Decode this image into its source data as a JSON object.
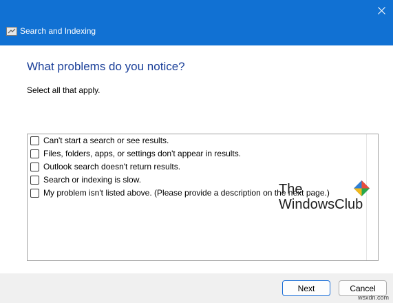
{
  "window": {
    "title": "Search and Indexing",
    "accent_color": "#1171d3",
    "close_icon": "close-icon"
  },
  "page": {
    "heading": "What problems do you notice?",
    "instruction": "Select all that apply."
  },
  "options": [
    {
      "label": "Can't start a search or see results.",
      "checked": false
    },
    {
      "label": "Files, folders, apps, or settings don't appear in results.",
      "checked": false
    },
    {
      "label": "Outlook search doesn't return results.",
      "checked": false
    },
    {
      "label": "Search or indexing is slow.",
      "checked": false
    },
    {
      "label": "My problem isn't listed above. (Please provide a description on the next page.)",
      "checked": false
    }
  ],
  "buttons": {
    "next": "Next",
    "cancel": "Cancel"
  },
  "watermark": {
    "line1": "The",
    "line2": "WindowsClub",
    "credit": "wsxdn.com"
  }
}
